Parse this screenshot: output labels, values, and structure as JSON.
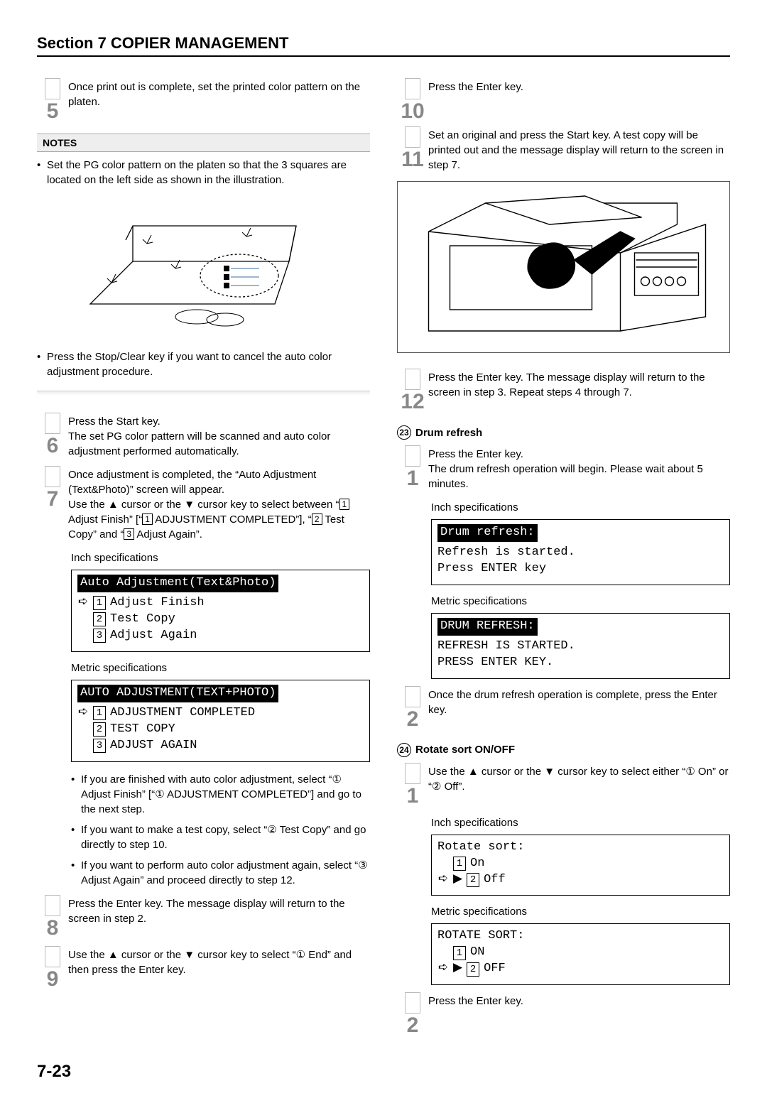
{
  "header": "Section 7  COPIER MANAGEMENT",
  "page_number": "7-23",
  "left": {
    "step5": "Once print out is complete, set the printed color pattern on the platen.",
    "notes_label": "NOTES",
    "note1": "Set the PG color pattern on the platen so that the 3 squares are located on the left side as shown in the illustration.",
    "note2": "Press the Stop/Clear key if you want to cancel the auto color adjustment procedure.",
    "step6a": "Press the Start key.",
    "step6b": "The set PG color pattern will be scanned and auto color adjustment performed automatically.",
    "step7a": "Once adjustment is completed, the “Auto Adjustment (Text&Photo)” screen will appear.",
    "step7b_prefix": "Use the ▲ cursor or the ▼ cursor key to select between “",
    "step7b_opt1": "1",
    "step7b_mid1": " Adjust Finish” [“",
    "step7b_opt1b": "1",
    "step7b_mid2": " ADJUSTMENT COMPLETED”], “",
    "step7b_opt2": "2",
    "step7b_mid3": " Test Copy” and “",
    "step7b_opt3": "3",
    "step7b_end": " Adjust Again”.",
    "inch_label": "Inch specifications",
    "metric_label": "Metric specifications",
    "lcd1_title": "Auto Adjustment(Text&Photo)",
    "lcd1_r1": "Adjust Finish",
    "lcd1_r2": "Test Copy",
    "lcd1_r3": "Adjust Again",
    "lcd2_title": "AUTO ADJUSTMENT(TEXT+PHOTO)",
    "lcd2_r1": "ADJUSTMENT COMPLETED",
    "lcd2_r2": "TEST COPY",
    "lcd2_r3": "ADJUST AGAIN",
    "b1": "If you are finished with auto color adjustment, select “① Adjust Finish” [“① ADJUSTMENT COMPLETED”] and go to the next step.",
    "b2": "If you want to make a test copy, select “② Test Copy” and go directly to step 10.",
    "b3": "If you want to perform auto color adjustment again, select “③ Adjust Again” and proceed directly to step 12.",
    "step8": "Press the Enter key. The message display will return to the screen in step 2.",
    "step9": "Use the ▲ cursor or the ▼ cursor key to select “① End” and then press the Enter key."
  },
  "right": {
    "step10": "Press the Enter key.",
    "step11": "Set an original and press the Start key. A test copy will be printed out and the message display will return to the screen in step 7.",
    "step12": "Press the Enter key. The message display will return to the screen in step 3. Repeat steps 4 through 7.",
    "sec23_num": "23",
    "sec23_title": "Drum refresh",
    "dr1a": "Press the Enter key.",
    "dr1b": "The drum refresh operation will begin. Please wait about 5 minutes.",
    "inch_label": "Inch specifications",
    "metric_label": "Metric specifications",
    "lcd_dr1_title": "Drum refresh:",
    "lcd_dr1_l1": "Refresh is started.",
    "lcd_dr1_l2": "Press ENTER key",
    "lcd_dr2_title": "DRUM REFRESH:",
    "lcd_dr2_l1": "REFRESH IS STARTED.",
    "lcd_dr2_l2": "PRESS ENTER KEY.",
    "dr2": "Once the drum refresh operation is complete, press the Enter key.",
    "sec24_num": "24",
    "sec24_title": "Rotate sort ON/OFF",
    "rs1": "Use the ▲ cursor or the ▼ cursor key to select either “① On” or “② Off”.",
    "lcd_rs1_title": "Rotate sort:",
    "lcd_rs1_r1": "On",
    "lcd_rs1_r2": "Off",
    "lcd_rs2_title": "ROTATE SORT:",
    "lcd_rs2_r1": "ON",
    "lcd_rs2_r2": "OFF",
    "rs2": "Press the Enter key."
  }
}
